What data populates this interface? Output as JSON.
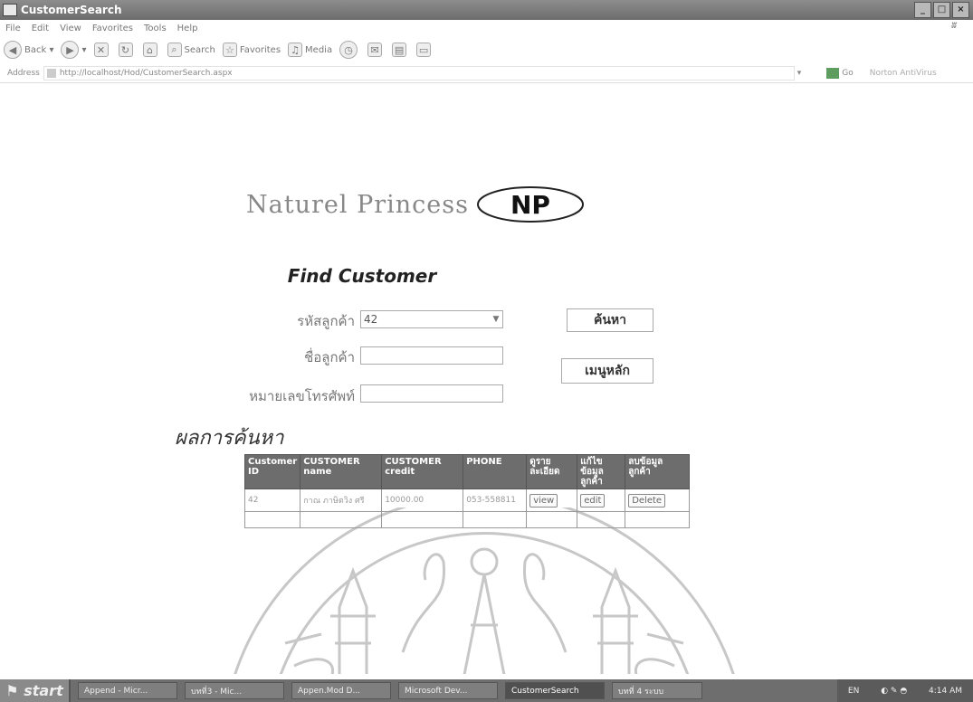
{
  "window": {
    "title": "CustomerSearch",
    "buttons": [
      "_",
      "□",
      "×"
    ]
  },
  "menu": {
    "items": [
      "File",
      "Edit",
      "View",
      "Favorites",
      "Tools",
      "Help"
    ]
  },
  "toolbar": {
    "back": "Back",
    "search": "Search",
    "favorites": "Favorites",
    "media": "Media"
  },
  "address": {
    "label": "Address",
    "url": "http://localhost/Hod/CustomerSearch.aspx",
    "go": "Go",
    "links": "Norton AntiVirus"
  },
  "brand": {
    "name": "Naturel Princess",
    "logo": "NP"
  },
  "form": {
    "heading": "Find Customer",
    "customer_id_label": "รหัสลูกค้า",
    "customer_id_value": "42",
    "customer_name_label": "ชื่อลูกค้า",
    "phone_label": "หมายเลขโทรศัพท์",
    "search_button": "ค้นหา",
    "menu_button": "เมนูหลัก"
  },
  "results": {
    "title": "ผลการค้นหา",
    "columns": [
      "Customer ID",
      "CUSTOMER name",
      "CUSTOMER credit",
      "PHONE",
      "ดูราย ละเอียด",
      "แก้ไข ข้อมูล ลูกค้า",
      "ลบข้อมูล ลูกค้า"
    ],
    "rows": [
      {
        "id": "42",
        "name": "กาณ ภาษิตวิง ศรี",
        "credit": "10000.00",
        "phone": "053-558811",
        "view": "view",
        "edit": "edit",
        "delete": "Delete"
      }
    ]
  },
  "taskbar": {
    "start": "start",
    "tasks": [
      "Append - Micr...",
      "บทที่3 - Mic...",
      "Appen.Mod D...",
      "Microsoft Dev...",
      "CustomerSearch",
      "บทที่ 4 ระบบ"
    ],
    "tray_lang": "EN",
    "clock": "4:14 AM"
  }
}
